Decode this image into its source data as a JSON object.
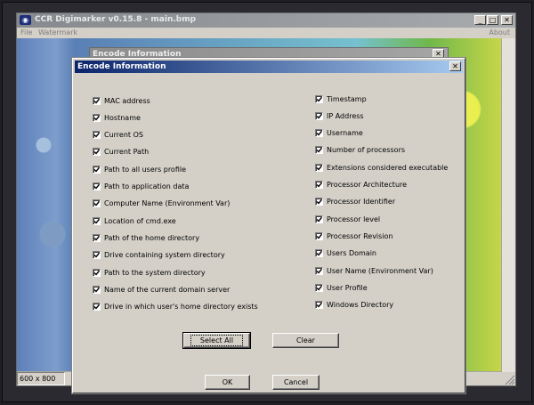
{
  "main_window": {
    "title": "CCR Digimarker v0.15.8 - main.bmp",
    "menu": [
      "File",
      "Watermark",
      "About"
    ],
    "status": "600 x 800"
  },
  "background_dialog": {
    "title": "Encode Information"
  },
  "dialog": {
    "title": "Encode Information",
    "left_items": [
      {
        "label": "MAC address",
        "checked": true
      },
      {
        "label": "Hostname",
        "checked": true
      },
      {
        "label": "Current OS",
        "checked": true
      },
      {
        "label": "Current Path",
        "checked": true
      },
      {
        "label": "Path to all users profile",
        "checked": true
      },
      {
        "label": "Path to application data",
        "checked": true
      },
      {
        "label": "Computer Name (Environment Var)",
        "checked": true
      },
      {
        "label": "Location of cmd.exe",
        "checked": true
      },
      {
        "label": "Path of the home directory",
        "checked": true
      },
      {
        "label": "Drive containing system directory",
        "checked": true
      },
      {
        "label": "Path to the system directory",
        "checked": true
      },
      {
        "label": "Name of the current domain server",
        "checked": true
      },
      {
        "label": "Drive in which user's home directory exists",
        "checked": true
      }
    ],
    "right_items": [
      {
        "label": "Timestamp",
        "checked": true
      },
      {
        "label": "IP Address",
        "checked": true
      },
      {
        "label": "Username",
        "checked": true
      },
      {
        "label": "Number of processors",
        "checked": true
      },
      {
        "label": "Extensions considered executable",
        "checked": true
      },
      {
        "label": "Processor Architecture",
        "checked": true
      },
      {
        "label": "Processor Identifier",
        "checked": true
      },
      {
        "label": "Processor level",
        "checked": true
      },
      {
        "label": "Processor Revision",
        "checked": true
      },
      {
        "label": "Users Domain",
        "checked": true
      },
      {
        "label": "User Name (Environment Var)",
        "checked": true
      },
      {
        "label": "User Profile",
        "checked": true
      },
      {
        "label": "Windows Directory",
        "checked": true
      }
    ],
    "select_all_label": "Select All",
    "clear_label": "Clear",
    "ok_label": "OK",
    "cancel_label": "Cancel"
  }
}
